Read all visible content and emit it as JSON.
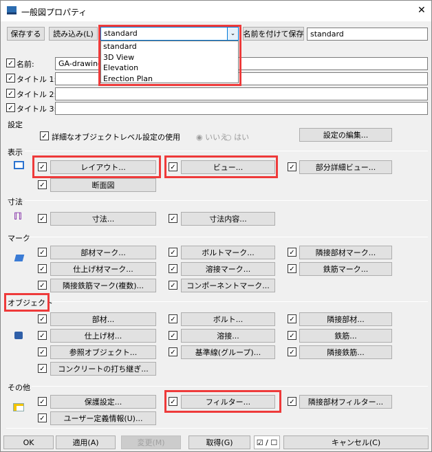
{
  "window": {
    "title": "一般図プロパティ",
    "close": "✕"
  },
  "toolbar": {
    "save": "保存する",
    "load": "読み込み(L)",
    "preset_value": "standard",
    "save_as": "名前を付けて保存",
    "save_as_value": "standard",
    "dropdown_options": [
      "standard",
      "3D View",
      "Elevation",
      "Erection Plan"
    ]
  },
  "fields": [
    {
      "label": "名前:",
      "value": "GA-drawing"
    },
    {
      "label": "タイトル 1:",
      "value": ""
    },
    {
      "label": "タイトル 2:",
      "value": ""
    },
    {
      "label": "タイトル 3:",
      "value": ""
    }
  ],
  "settings": {
    "header": "設定",
    "detail_label": "詳細なオブジェクトレベル設定の使用",
    "radio_no": "いいえ",
    "radio_yes": "はい",
    "edit": "設定の編集..."
  },
  "display": {
    "header": "表示",
    "buttons": [
      "レイアウト...",
      "ビュー...",
      "部分詳細ビュー...",
      "断面図"
    ]
  },
  "dimension": {
    "header": "寸法",
    "buttons": [
      "寸法...",
      "寸法内容..."
    ]
  },
  "mark": {
    "header": "マーク",
    "buttons": [
      "部材マーク...",
      "ボルトマーク...",
      "隣接部材マーク...",
      "仕上げ材マーク...",
      "溶接マーク...",
      "鉄筋マーク...",
      "隣接鉄筋マーク(複数)...",
      "コンポーネントマーク..."
    ]
  },
  "object": {
    "header": "オブジェクト",
    "buttons": [
      "部材...",
      "ボルト...",
      "隣接部材...",
      "仕上げ材...",
      "溶接...",
      "鉄筋...",
      "参照オブジェクト...",
      "基準線(グループ)...",
      "隣接鉄筋...",
      "コンクリートの打ち継ぎ..."
    ]
  },
  "other": {
    "header": "その他",
    "buttons": [
      "保護設定...",
      "フィルター...",
      "隣接部材フィルター...",
      "ユーザー定義情報(U)..."
    ]
  },
  "footer": {
    "ok": "OK",
    "apply": "適用(A)",
    "modify": "変更(M)",
    "get": "取得(G)",
    "toggle": "☑ / ☐",
    "cancel": "キャンセル(C)"
  },
  "colors": {
    "highlight": "#ee3a3a"
  }
}
